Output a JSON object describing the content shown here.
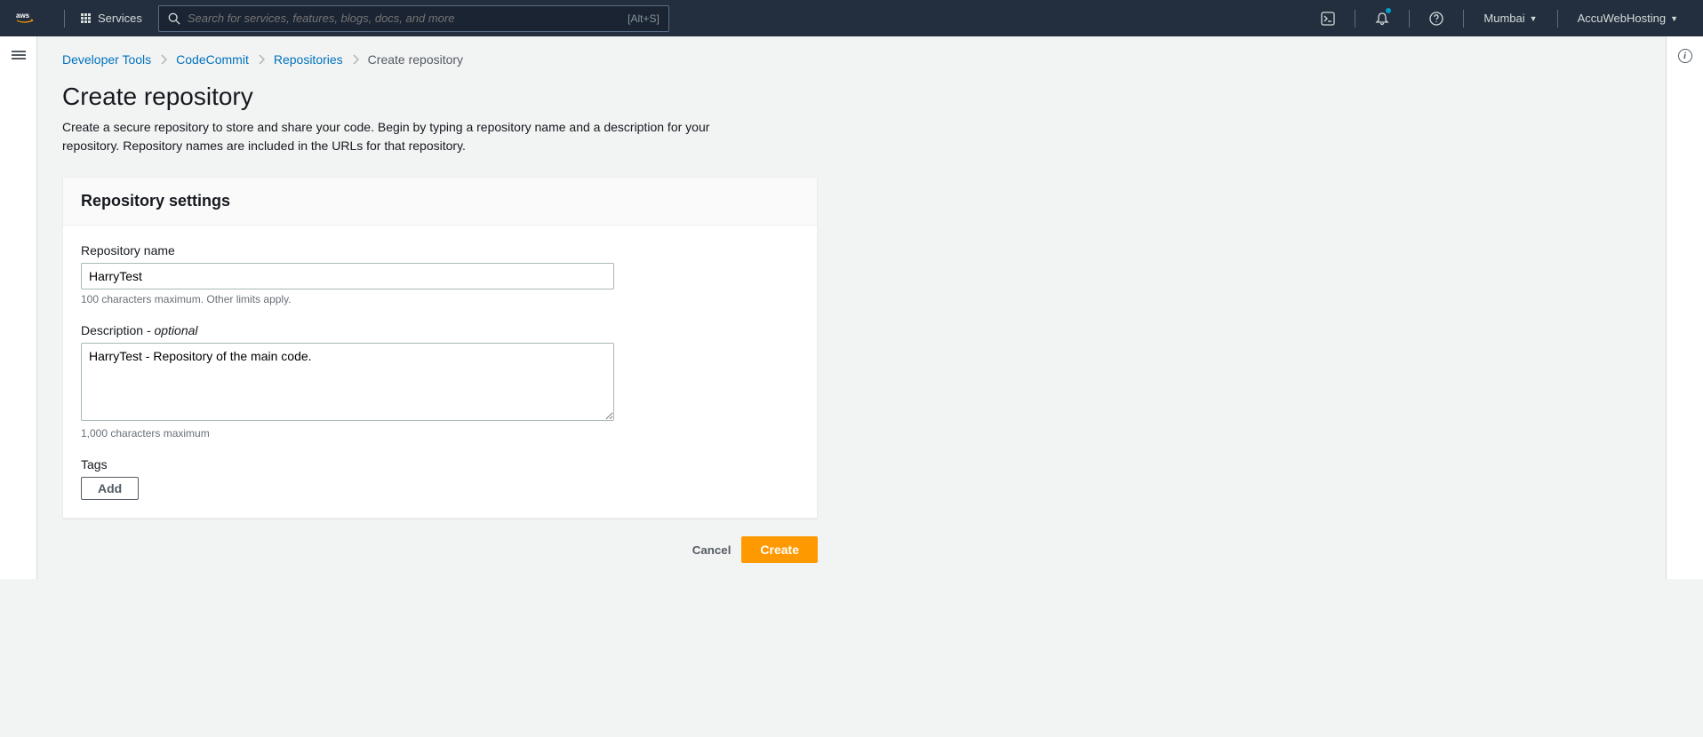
{
  "nav": {
    "services_label": "Services",
    "search_placeholder": "Search for services, features, blogs, docs, and more",
    "search_shortcut": "[Alt+S]",
    "region": "Mumbai",
    "account": "AccuWebHosting"
  },
  "breadcrumb": {
    "items": [
      {
        "label": "Developer Tools",
        "link": true
      },
      {
        "label": "CodeCommit",
        "link": true
      },
      {
        "label": "Repositories",
        "link": true
      },
      {
        "label": "Create repository",
        "link": false
      }
    ]
  },
  "page": {
    "title": "Create repository",
    "description": "Create a secure repository to store and share your code. Begin by typing a repository name and a description for your repository. Repository names are included in the URLs for that repository."
  },
  "panel": {
    "title": "Repository settings",
    "repo_name_label": "Repository name",
    "repo_name_value": "HarryTest",
    "repo_name_hint": "100 characters maximum. Other limits apply.",
    "description_label": "Description",
    "description_optional": " - optional",
    "description_value": "HarryTest - Repository of the main code.",
    "description_hint": "1,000 characters maximum",
    "tags_label": "Tags",
    "add_button": "Add"
  },
  "actions": {
    "cancel": "Cancel",
    "create": "Create"
  }
}
